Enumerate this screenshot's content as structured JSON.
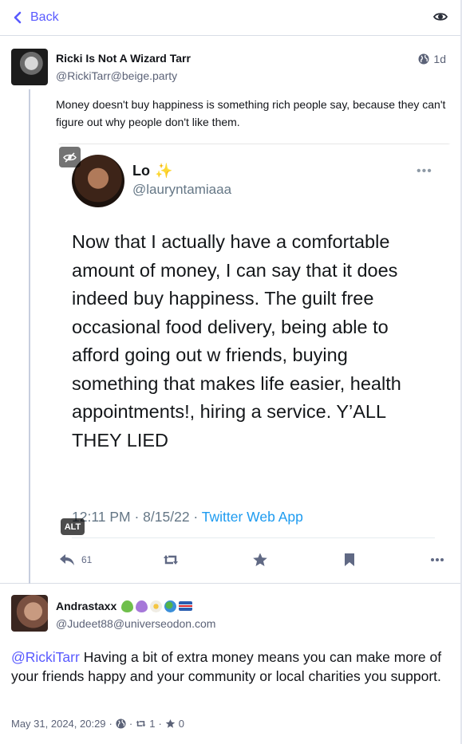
{
  "topbar": {
    "back_label": "Back"
  },
  "status1": {
    "display_name": "Ricki Is Not A Wizard Tarr",
    "handle": "@RickiTarr@beige.party",
    "time": "1d",
    "content": "Money doesn't buy happiness is something rich people say, because they can't figure out why people don't like them.",
    "media": {
      "alt_badge": "ALT",
      "tweet": {
        "name": "Lo",
        "handle": "@lauryntamiaaa",
        "more": "•••",
        "text": "Now that I actually have a comfortable amount of money, I can say that it does indeed buy happiness. The guilt free occasional food delivery, being able to afford going out w friends, buying something that makes life easier, health appointments!, hiring a service. Y’ALL THEY LIED",
        "meta_prefix": "12:11 PM · 8/15/22 · ",
        "meta_app": "Twitter Web App"
      }
    },
    "actions": {
      "reply_count": "61"
    }
  },
  "status2": {
    "display_name": "Andrastaxx",
    "handle": "@Judeet88@universeodon.com",
    "mention": "@RickiTarr",
    "content": " Having a bit of extra money means you can make more of your friends happy and your community or local charities you support.",
    "date": "May 31, 2024, 20:29",
    "sep": "·",
    "boosts": "1",
    "favs": "0"
  },
  "colors": {
    "accent": "#595aff",
    "link_blue": "#1d9bf0",
    "muted": "#5b6277"
  },
  "icons": [
    "chevron-left-icon",
    "eye-icon",
    "globe-icon",
    "eye-slash-icon",
    "reply-icon",
    "retweet-icon",
    "star-icon",
    "bookmark-icon",
    "ellipsis-icon"
  ]
}
